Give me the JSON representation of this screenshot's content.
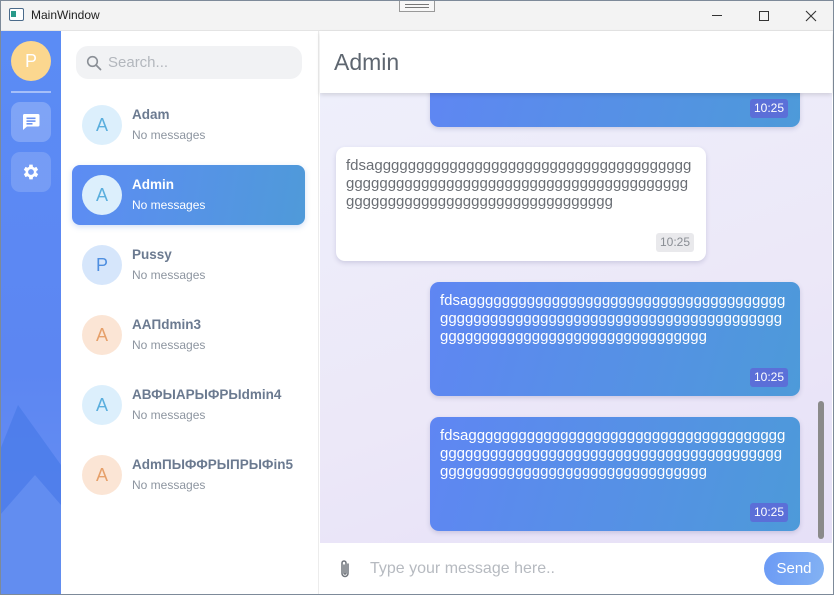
{
  "window": {
    "title": "MainWindow",
    "icon": "window-app-icon",
    "controls": [
      "minimize-icon",
      "maximize-icon",
      "close-icon"
    ]
  },
  "rail": {
    "avatar_letter": "P",
    "avatar_color": "#fbd78f",
    "buttons": [
      "chat-icon",
      "gear-icon"
    ],
    "accent": "#5b8cf5"
  },
  "search": {
    "placeholder": "Search...",
    "value": ""
  },
  "contacts": [
    {
      "letter": "A",
      "name": "Adam",
      "preview": "No messages",
      "avatar_bg": "#dceffc",
      "avatar_fg": "#5aaedd",
      "active": false
    },
    {
      "letter": "A",
      "name": "Admin",
      "preview": "No messages",
      "avatar_bg": "#dceffc",
      "avatar_fg": "#5aaedd",
      "active": true
    },
    {
      "letter": "P",
      "name": "Pussy",
      "preview": "No messages",
      "avatar_bg": "#d6e6fb",
      "avatar_fg": "#4f8fe0",
      "active": false
    },
    {
      "letter": "A",
      "name": "AAПdmin3",
      "preview": "No messages",
      "avatar_bg": "#fbe5d5",
      "avatar_fg": "#e6a06a",
      "active": false
    },
    {
      "letter": "A",
      "name": "АВФЫАРЫФРЫdmin4",
      "preview": "No messages",
      "avatar_bg": "#dceffc",
      "avatar_fg": "#5aaedd",
      "active": false
    },
    {
      "letter": "A",
      "name": "AdmПЫФФРЫПРЫФin5",
      "preview": "No messages",
      "avatar_bg": "#fbe5d5",
      "avatar_fg": "#e6a06a",
      "active": false
    }
  ],
  "chat": {
    "title": "Admin",
    "messages": [
      {
        "direction": "out",
        "text": "",
        "time": "10:25"
      },
      {
        "direction": "in",
        "text": "fdsaggggggggggggggggggggggggggggggggggggggggggggggggggggggggggggggggggggggggggggggggggggggggggggggggggggggggggggggg",
        "time": "10:25"
      },
      {
        "direction": "out",
        "text": "fdsaggggggggggggggggggggggggggggggggggggggggggggggggggggggggggggggggggggggggggggggggggggggggggggggggggggggggggggggg",
        "time": "10:25"
      },
      {
        "direction": "out",
        "text": "fdsaggggggggggggggggggggggggggggggggggggggggggggggggggggggggggggggggggggggggggggggggggggggggggggggggggggggggggggggg",
        "time": "10:25"
      }
    ]
  },
  "composer": {
    "placeholder": "Type your message here..",
    "value": "",
    "send_label": "Send",
    "attach_icon": "paperclip-icon"
  }
}
